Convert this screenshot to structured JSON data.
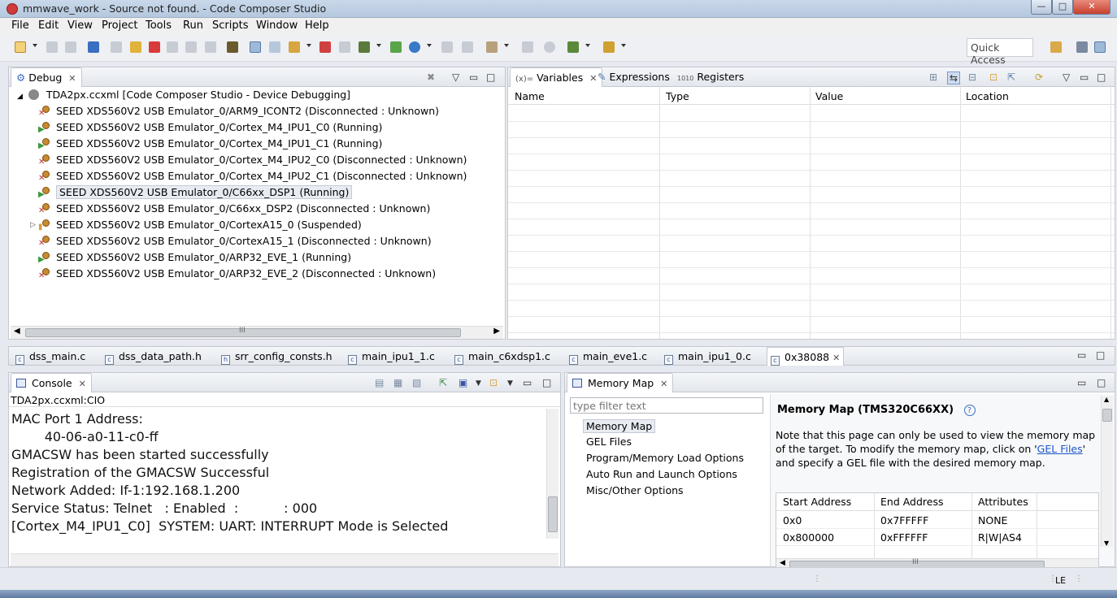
{
  "window": {
    "title": "mmwave_work - Source not found. - Code Composer Studio",
    "buttons": [
      "—",
      "□",
      "✕"
    ]
  },
  "menu": [
    "File",
    "Edit",
    "View",
    "Project",
    "Tools",
    "Run",
    "Scripts",
    "Window",
    "Help"
  ],
  "quick_access": "Quick Access",
  "debug": {
    "tab": "Debug",
    "root": "TDA2px.ccxml [Code Composer Studio - Device Debugging]",
    "items": [
      {
        "label": "SEED XDS560V2 USB Emulator_0/ARM9_ICONT2 (Disconnected : Unknown)",
        "status": "disconnected"
      },
      {
        "label": "SEED XDS560V2 USB Emulator_0/Cortex_M4_IPU1_C0 (Running)",
        "status": "running"
      },
      {
        "label": "SEED XDS560V2 USB Emulator_0/Cortex_M4_IPU1_C1 (Running)",
        "status": "running"
      },
      {
        "label": "SEED XDS560V2 USB Emulator_0/Cortex_M4_IPU2_C0 (Disconnected : Unknown)",
        "status": "disconnected"
      },
      {
        "label": "SEED XDS560V2 USB Emulator_0/Cortex_M4_IPU2_C1 (Disconnected : Unknown)",
        "status": "disconnected"
      },
      {
        "label": "SEED XDS560V2 USB Emulator_0/C66xx_DSP1 (Running)",
        "status": "running"
      },
      {
        "label": "SEED XDS560V2 USB Emulator_0/C66xx_DSP2 (Disconnected : Unknown)",
        "status": "disconnected"
      },
      {
        "label": "SEED XDS560V2 USB Emulator_0/CortexA15_0 (Suspended)",
        "status": "suspended"
      },
      {
        "label": "SEED XDS560V2 USB Emulator_0/CortexA15_1 (Disconnected : Unknown)",
        "status": "disconnected"
      },
      {
        "label": "SEED XDS560V2 USB Emulator_0/ARP32_EVE_1 (Running)",
        "status": "running"
      },
      {
        "label": "SEED XDS560V2 USB Emulator_0/ARP32_EVE_2 (Disconnected : Unknown)",
        "status": "disconnected"
      }
    ],
    "scroll_marker": "III"
  },
  "variables": {
    "tabs": [
      "Variables",
      "Expressions",
      "Registers"
    ],
    "tab_prefixes": [
      "(x)=",
      "",
      "1010"
    ],
    "columns": [
      "Name",
      "Type",
      "Value",
      "Location"
    ]
  },
  "editor_tabs": [
    "dss_main.c",
    "dss_data_path.h",
    "srr_config_consts.h",
    "main_ipu1_1.c",
    "main_c6xdsp1.c",
    "main_eve1.c",
    "main_ipu1_0.c",
    "0x38088"
  ],
  "console": {
    "tab": "Console",
    "source": "TDA2px.ccxml:CIO",
    "lines": [
      "MAC Port 1 Address:",
      "        40-06-a0-11-c0-ff",
      "GMACSW has been started successfully",
      "Registration of the GMACSW Successful",
      "Network Added: If-1:192.168.1.200",
      "Service Status: Telnet   : Enabled  :           : 000",
      "[Cortex_M4_IPU1_C0]  SYSTEM: UART: INTERRUPT Mode is Selected"
    ]
  },
  "memory_map": {
    "tab": "Memory Map",
    "filter_placeholder": "type filter text",
    "nav": [
      "Memory Map",
      "GEL Files",
      "Program/Memory Load Options",
      "Auto Run and Launch Options",
      "Misc/Other Options"
    ],
    "heading": "Memory Map (TMS320C66XX)",
    "help": "?",
    "desc_before": "Note that this page can only be used to view the memory map of the target.  To modify the memory map, click on '",
    "desc_link": "GEL Files",
    "desc_after": "' and specify a GEL file with the desired memory map.",
    "columns": [
      "Start Address",
      "End Address",
      "Attributes"
    ],
    "rows": [
      [
        "0x0",
        "0x7FFFFF",
        "NONE"
      ],
      [
        "0x800000",
        "0xFFFFFF",
        "R|W|AS4"
      ]
    ],
    "scroll_marker": "III"
  },
  "status": {
    "mode": "LE"
  }
}
